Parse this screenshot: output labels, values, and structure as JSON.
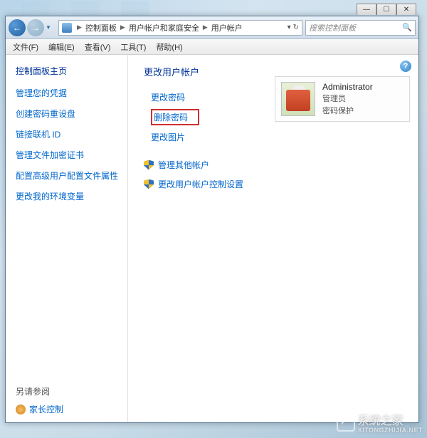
{
  "titlebar": {
    "min": "—",
    "max": "☐",
    "close": "✕"
  },
  "nav": {
    "back": "←",
    "forward": "→"
  },
  "breadcrumb": {
    "items": [
      "控制面板",
      "用户帐户和家庭安全",
      "用户帐户"
    ],
    "refresh": "↻"
  },
  "search": {
    "placeholder": "搜索控制面板"
  },
  "menu": {
    "file": "文件(F)",
    "edit": "编辑(E)",
    "view": "查看(V)",
    "tools": "工具(T)",
    "help": "帮助(H)"
  },
  "sidebar": {
    "title": "控制面板主页",
    "links": [
      "管理您的凭据",
      "创建密码重设盘",
      "链接联机 ID",
      "管理文件加密证书",
      "配置高级用户配置文件属性",
      "更改我的环境变量"
    ],
    "footer_title": "另请参阅",
    "footer_link": "家长控制"
  },
  "main": {
    "title": "更改用户帐户",
    "actions": {
      "change_password": "更改密码",
      "delete_password": "删除密码",
      "change_picture": "更改图片"
    },
    "other": {
      "manage_other": "管理其他帐户",
      "uac_settings": "更改用户帐户控制设置"
    }
  },
  "account": {
    "name": "Administrator",
    "role": "管理员",
    "protection": "密码保护"
  },
  "help": "?",
  "watermark": {
    "text": "系统之家",
    "sub": "XITONGZHIJIA.NET"
  }
}
